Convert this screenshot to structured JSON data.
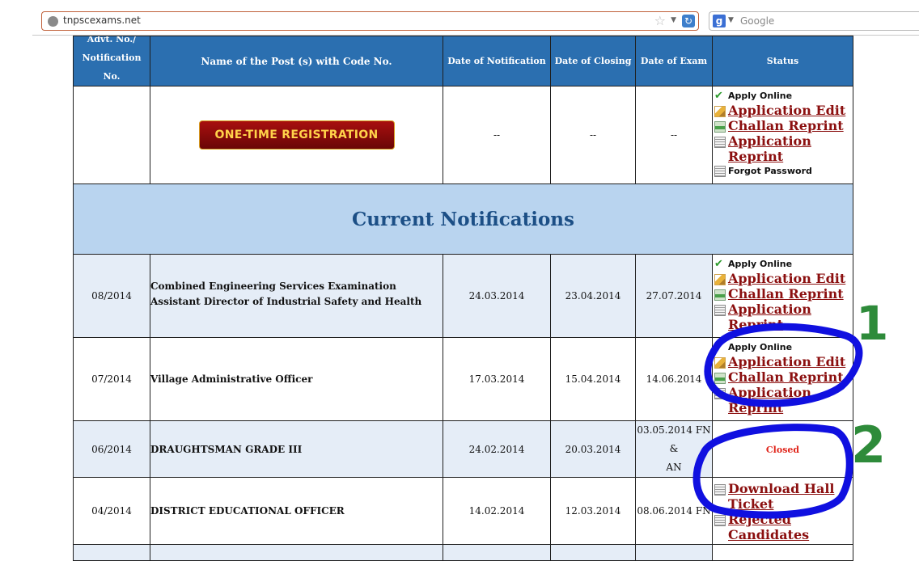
{
  "browser": {
    "url": "tnpscexams.net",
    "search_placeholder": "Google"
  },
  "table": {
    "headers": {
      "adv_line1": "Advt. No./",
      "adv_line2": "Notification No.",
      "name": "Name of the Post (s) with Code No.",
      "notification": "Date of Notification",
      "closing": "Date of Closing",
      "exam": "Date of Exam",
      "status": "Status"
    },
    "registration": {
      "button": "ONE-TIME REGISTRATION",
      "notification": "--",
      "closing": "--",
      "exam": "--",
      "status": {
        "apply": "Apply Online",
        "edit": "Application Edit",
        "challan": "Challan Reprint",
        "reprint_line1": "Application",
        "reprint_line2": "Reprint",
        "forgot": "Forgot Password"
      }
    },
    "section_title": "Current Notifications",
    "rows": [
      {
        "no": "08/2014",
        "name_line1": "Combined Engineering Services Examination",
        "name_line2": "Assistant Director of Industrial Safety and Health",
        "notification": "24.03.2014",
        "closing": "23.04.2014",
        "exam": "27.07.2014",
        "status": {
          "apply": "Apply Online",
          "edit": "Application Edit",
          "challan": "Challan Reprint",
          "reprint_line1": "Application",
          "reprint_line2": "Reprint"
        }
      },
      {
        "no": "07/2014",
        "name_line1": "Village Administrative Officer",
        "notification": "17.03.2014",
        "closing": "15.04.2014",
        "exam": "14.06.2014",
        "status": {
          "apply": "Apply Online",
          "edit": "Application Edit",
          "challan": "Challan Reprint",
          "reprint_line1": "Application",
          "reprint_line2": "Reprint"
        }
      },
      {
        "no": "06/2014",
        "name_line1": "DRAUGHTSMAN GRADE III",
        "notification": "24.02.2014",
        "closing": "20.03.2014",
        "exam_line1": "03.05.2014 FN &",
        "exam_line2": "AN",
        "status_text": "Closed"
      },
      {
        "no": "04/2014",
        "name_line1": "DISTRICT EDUCATIONAL OFFICER",
        "notification": "14.02.2014",
        "closing": "12.03.2014",
        "exam": "08.06.2014 FN",
        "status": {
          "hall_line1": "Download Hall",
          "hall_line2": "Ticket",
          "rejected_line1": "Rejected",
          "rejected_line2": "Candidates"
        }
      }
    ]
  },
  "annotations": {
    "marker_1": "1",
    "marker_2": "2",
    "marker_colors": {
      "circle": "#1010e0",
      "digit": "#2e8b3a"
    }
  },
  "colors": {
    "header_bg": "#2b6fb0",
    "section_bg": "#b9d4ef",
    "row_alt_bg": "#e5edf7",
    "link": "#8b0f0f"
  }
}
